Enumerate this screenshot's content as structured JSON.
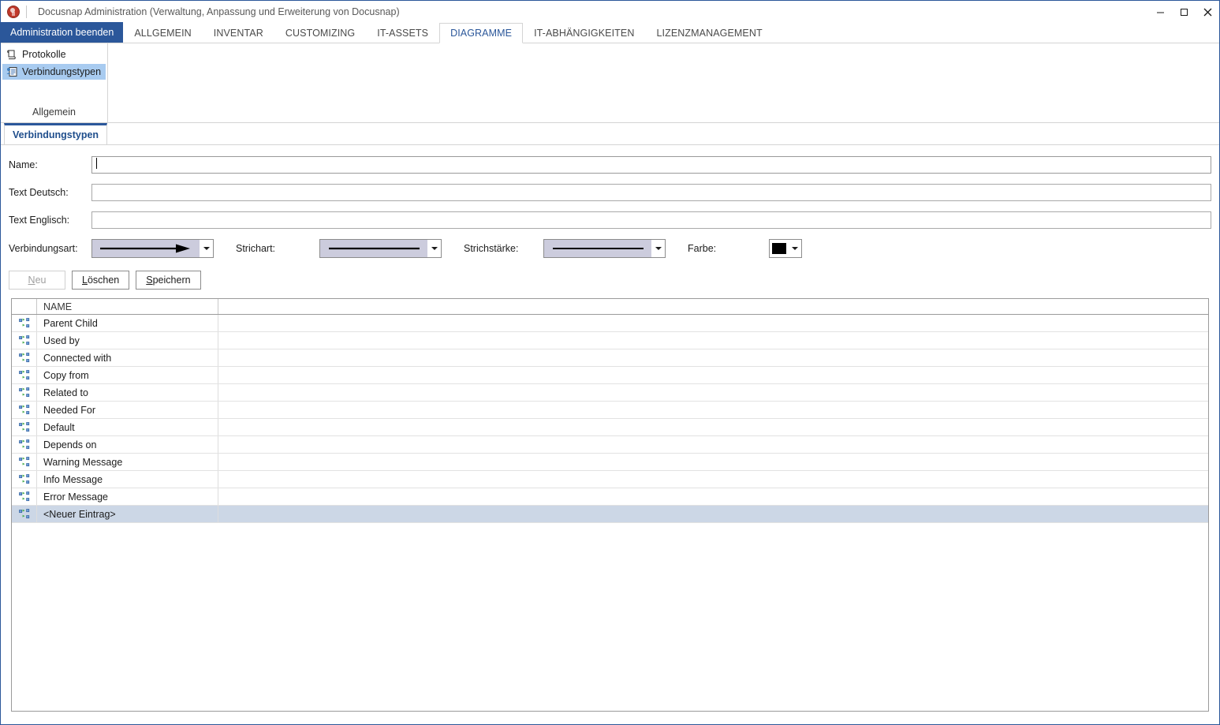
{
  "window": {
    "title": "Docusnap Administration (Verwaltung, Anpassung und Erweiterung von Docusnap)",
    "app_icon": "docusnap-logo-icon",
    "controls": {
      "minimize": "minimize-icon",
      "maximize": "maximize-icon",
      "close": "close-icon"
    },
    "accent_color": "#2b579a",
    "border_color": "#2b579a"
  },
  "ribbon": {
    "exit_tab": "Administration beenden",
    "tabs": [
      {
        "label": "ALLGEMEIN",
        "active": false
      },
      {
        "label": "INVENTAR",
        "active": false
      },
      {
        "label": "CUSTOMIZING",
        "active": false
      },
      {
        "label": "IT-ASSETS",
        "active": false
      },
      {
        "label": "DIAGRAMME",
        "active": true
      },
      {
        "label": "IT-ABHÄNGIGKEITEN",
        "active": false
      },
      {
        "label": "LIZENZMANAGEMENT",
        "active": false
      }
    ],
    "group": {
      "label": "Allgemein",
      "items": [
        {
          "label": "Protokolle",
          "icon": "protocol-icon",
          "selected": false
        },
        {
          "label": "Verbindungstypen",
          "icon": "connection-types-icon",
          "selected": true
        }
      ]
    }
  },
  "document_tabs": [
    {
      "label": "Verbindungstypen",
      "active": true
    }
  ],
  "form": {
    "fields": [
      {
        "label": "Name:",
        "value": "",
        "placeholder": "",
        "focused": true
      },
      {
        "label": "Text Deutsch:",
        "value": "",
        "placeholder": "",
        "focused": false
      },
      {
        "label": "Text Englisch:",
        "value": "",
        "placeholder": "",
        "focused": false
      }
    ],
    "style_row": [
      {
        "label": "Verbindungsart:",
        "preview": "arrow-line",
        "selected_value": "Pfeil"
      },
      {
        "label": "Strichart:",
        "preview": "solid-line",
        "selected_value": "Durchgezogen"
      },
      {
        "label": "Strichstärke:",
        "preview": "thin-line",
        "selected_value": "Dünn"
      },
      {
        "label": "Farbe:",
        "preview": "color-swatch",
        "selected_value": "#000000"
      }
    ]
  },
  "buttons": [
    {
      "label": "Neu",
      "mnemonic": "N",
      "disabled": true
    },
    {
      "label": "Löschen",
      "mnemonic": "L",
      "disabled": false
    },
    {
      "label": "Speichern",
      "mnemonic": "S",
      "disabled": false
    }
  ],
  "grid": {
    "columns": [
      "",
      "NAME",
      ""
    ],
    "rows": [
      {
        "icon": "connection-type-icon",
        "name": "Parent Child",
        "selected": false
      },
      {
        "icon": "connection-type-icon",
        "name": "Used by",
        "selected": false
      },
      {
        "icon": "connection-type-icon",
        "name": "Connected with",
        "selected": false
      },
      {
        "icon": "connection-type-icon",
        "name": "Copy from",
        "selected": false
      },
      {
        "icon": "connection-type-icon",
        "name": "Related to",
        "selected": false
      },
      {
        "icon": "connection-type-icon",
        "name": "Needed For",
        "selected": false
      },
      {
        "icon": "connection-type-icon",
        "name": "Default",
        "selected": false
      },
      {
        "icon": "connection-type-icon",
        "name": "Depends on",
        "selected": false
      },
      {
        "icon": "connection-type-icon",
        "name": "Warning Message",
        "selected": false
      },
      {
        "icon": "connection-type-icon",
        "name": "Info Message",
        "selected": false
      },
      {
        "icon": "connection-type-icon",
        "name": "Error Message",
        "selected": false
      },
      {
        "icon": "connection-type-icon",
        "name": "<Neuer Eintrag>",
        "selected": true
      }
    ]
  }
}
